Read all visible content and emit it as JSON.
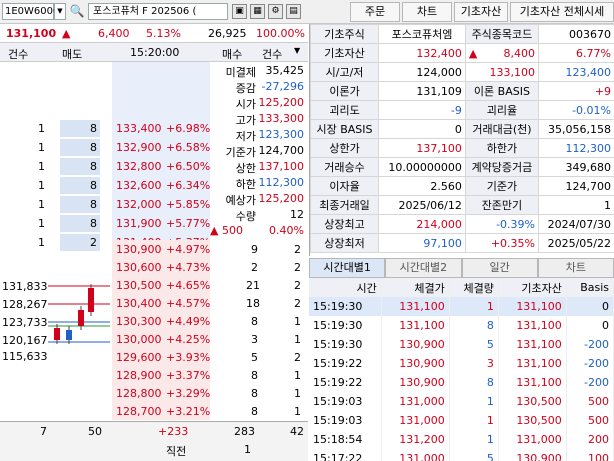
{
  "toolbar": {
    "code": "1E0W6000",
    "name": "포스코퓨처 F 202506 (",
    "buttons": [
      "주문",
      "차트",
      "기초자산",
      "기초자산 전체시세"
    ]
  },
  "quote": {
    "price": "131,100",
    "arrow": "▲",
    "change": "6,400",
    "pct": "5.13%",
    "volume": "26,925",
    "volpct": "100.00%"
  },
  "ob_header": {
    "c1": "건수",
    "c2": "매도",
    "time": "15:20:00",
    "c4": "매수",
    "c5": "건수"
  },
  "side_info": [
    [
      "미결제",
      "35,425"
    ],
    [
      "증감",
      "-27,296"
    ],
    [
      "시가",
      "125,200"
    ],
    [
      "고가",
      "133,300"
    ],
    [
      "저가",
      "123,300"
    ],
    [
      "기준가",
      "124,700"
    ],
    [
      "상한",
      "137,100"
    ],
    [
      "하한",
      "112,300"
    ],
    [
      "예상가",
      "125,200"
    ],
    [
      "수량",
      "12"
    ]
  ],
  "side_last": {
    "arrow": "▲",
    "val": "500",
    "pct": "0.40%"
  },
  "asks": [
    {
      "cnt": "1",
      "qty": "8",
      "price": "133,400",
      "pct": "+6.98%"
    },
    {
      "cnt": "1",
      "qty": "8",
      "price": "132,900",
      "pct": "+6.58%"
    },
    {
      "cnt": "1",
      "qty": "8",
      "price": "132,800",
      "pct": "+6.50%"
    },
    {
      "cnt": "1",
      "qty": "8",
      "price": "132,600",
      "pct": "+6.34%"
    },
    {
      "cnt": "1",
      "qty": "8",
      "price": "132,000",
      "pct": "+5.85%"
    },
    {
      "cnt": "1",
      "qty": "8",
      "price": "131,900",
      "pct": "+5.77%"
    },
    {
      "cnt": "1",
      "qty": "2",
      "price": "131,400",
      "pct": "+5.37%"
    }
  ],
  "bids": [
    {
      "price": "130,900",
      "pct": "+4.97%",
      "qty": "9",
      "cnt": "2"
    },
    {
      "price": "130,600",
      "pct": "+4.73%",
      "qty": "2",
      "cnt": "2"
    },
    {
      "price": "130,500",
      "pct": "+4.65%",
      "qty": "21",
      "cnt": "2"
    },
    {
      "price": "130,400",
      "pct": "+4.57%",
      "qty": "18",
      "cnt": "2"
    },
    {
      "price": "130,300",
      "pct": "+4.49%",
      "qty": "8",
      "cnt": "1"
    },
    {
      "price": "130,000",
      "pct": "+4.25%",
      "qty": "3",
      "cnt": "1"
    },
    {
      "price": "129,600",
      "pct": "+3.93%",
      "qty": "5",
      "cnt": "2"
    },
    {
      "price": "128,900",
      "pct": "+3.37%",
      "qty": "8",
      "cnt": "1"
    },
    {
      "price": "128,800",
      "pct": "+3.29%",
      "qty": "8",
      "cnt": "1"
    },
    {
      "price": "128,700",
      "pct": "+3.21%",
      "qty": "8",
      "cnt": "1"
    }
  ],
  "chart_levels": [
    "131,833",
    "128,267",
    "123,733",
    "120,167",
    "115,633"
  ],
  "totals": {
    "ask_cnt": "7",
    "ask_qty": "50",
    "diff": "+233",
    "bid_qty": "283",
    "bid_cnt": "42",
    "label": "직전",
    "last": "1"
  },
  "info": {
    "r1": [
      "기초주식",
      "포스코퓨처엠",
      "주식종목코드",
      "003670"
    ],
    "r2": [
      "기초자산",
      "132,400",
      "▲",
      "8,400",
      "6.77%"
    ],
    "r3": [
      "시/고/저",
      "124,000",
      "133,100",
      "123,400"
    ],
    "r4": [
      "이론가",
      "131,109",
      "이론 BASIS",
      "+9"
    ],
    "r5": [
      "괴리도",
      "-9",
      "괴리율",
      "-0.01%"
    ],
    "r6": [
      "시장 BASIS",
      "0",
      "거래대금(천)",
      "35,056,158"
    ],
    "r7": [
      "상한가",
      "137,100",
      "하한가",
      "112,300"
    ],
    "r8": [
      "거래승수",
      "10.00000000",
      "계약당증거금",
      "349,680"
    ],
    "r9": [
      "이자율",
      "2.560",
      "기준가",
      "124,700"
    ],
    "r10": [
      "최종거래일",
      "2025/06/12",
      "잔존만기",
      "1"
    ],
    "r11": [
      "상장최고",
      "214,000",
      "-0.39%",
      "2024/07/30"
    ],
    "r12": [
      "상장최저",
      "97,100",
      "+0.35%",
      "2025/05/22"
    ]
  },
  "tabs": [
    "시간대별1",
    "시간대별2",
    "일간",
    "차트"
  ],
  "trade_header": [
    "시간",
    "체결가",
    "체결량",
    "기초자산",
    "Basis"
  ],
  "trades": [
    [
      "15:19:30",
      "131,100",
      "1",
      "131,100",
      "0"
    ],
    [
      "15:19:30",
      "131,100",
      "8",
      "131,100",
      "0"
    ],
    [
      "15:19:30",
      "130,900",
      "5",
      "131,100",
      "-200"
    ],
    [
      "15:19:22",
      "130,900",
      "3",
      "131,100",
      "-200"
    ],
    [
      "15:19:22",
      "130,900",
      "8",
      "131,100",
      "-200"
    ],
    [
      "15:19:03",
      "131,000",
      "1",
      "130,500",
      "500"
    ],
    [
      "15:19:03",
      "131,000",
      "1",
      "130,500",
      "500"
    ],
    [
      "15:18:54",
      "131,200",
      "1",
      "131,000",
      "200"
    ],
    [
      "15:17:22",
      "131,000",
      "5",
      "130,900",
      "100"
    ]
  ]
}
